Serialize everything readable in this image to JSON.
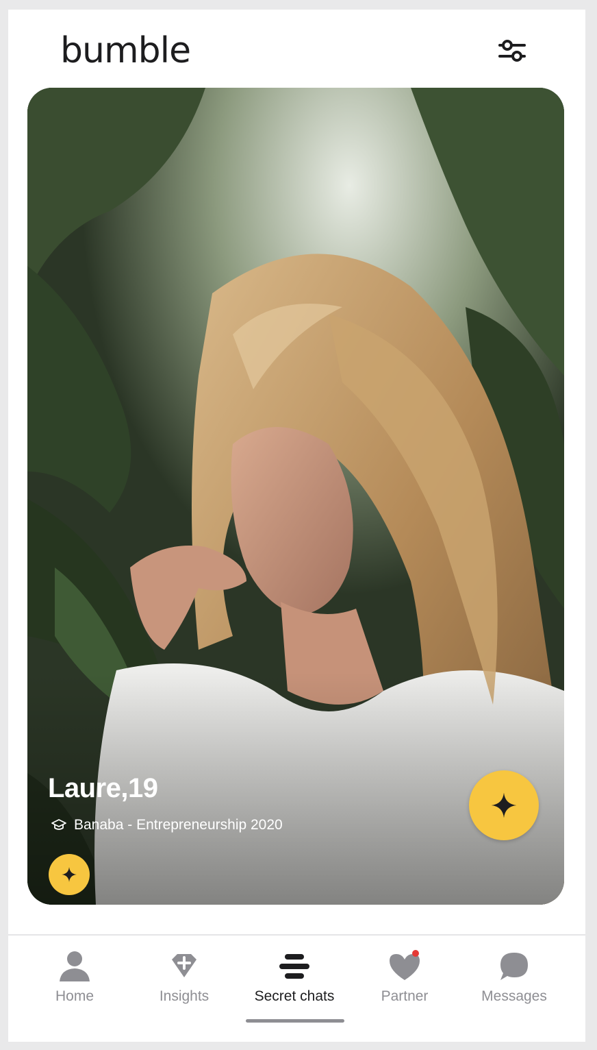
{
  "header": {
    "logo": "bumble",
    "filter_icon": "sliders-icon"
  },
  "profile": {
    "name_age": "Laure,19",
    "school": "Banaba - Entrepreneurship 2020",
    "school_icon": "graduation-cap-icon",
    "superswipe_icon": "sparkle-icon"
  },
  "nav": {
    "items": [
      {
        "label": "Home",
        "icon": "person-icon",
        "active": false
      },
      {
        "label": "Insights",
        "icon": "diamond-icon",
        "active": false
      },
      {
        "label": "Secret chats",
        "icon": "bumble-stripes-icon",
        "active": true
      },
      {
        "label": "Partner",
        "icon": "heart-icon",
        "active": false
      },
      {
        "label": "Messages",
        "icon": "chat-bubble-icon",
        "active": false
      }
    ]
  },
  "colors": {
    "accent": "#f7c640",
    "inactive": "#8e8e93",
    "active": "#1d1d1f",
    "notification_dot": "#e53935"
  }
}
